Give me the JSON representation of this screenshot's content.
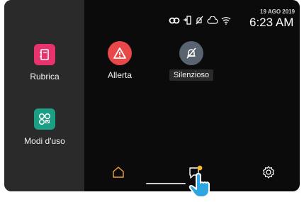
{
  "status_bar": {
    "date": "19 AGO 2019",
    "time": "6:23 AM",
    "icons": [
      "link-icon",
      "device-link-icon",
      "mute-icon",
      "cloud-icon",
      "wifi-icon"
    ]
  },
  "sidebar": {
    "items": [
      {
        "label": "Rubrica",
        "icon": "address-book-icon",
        "color": "#e8336c"
      },
      {
        "label": "Modi d'uso",
        "icon": "modes-icon",
        "color": "#1a9e84"
      }
    ]
  },
  "main": {
    "apps": [
      {
        "label": "Allerta",
        "icon": "alert-icon",
        "color": "#e8484a"
      },
      {
        "label": "Silenzioso",
        "icon": "mute-icon",
        "color": "#5a6470"
      }
    ]
  },
  "dock": {
    "items": [
      {
        "icon": "home-icon",
        "color": "#f2a23a"
      },
      {
        "icon": "messages-icon",
        "badge_color": "#f5b82e"
      },
      {
        "icon": "settings-icon"
      }
    ]
  },
  "pointer": {
    "icon": "hand-pointer-icon",
    "color": "#2fa6e0"
  }
}
